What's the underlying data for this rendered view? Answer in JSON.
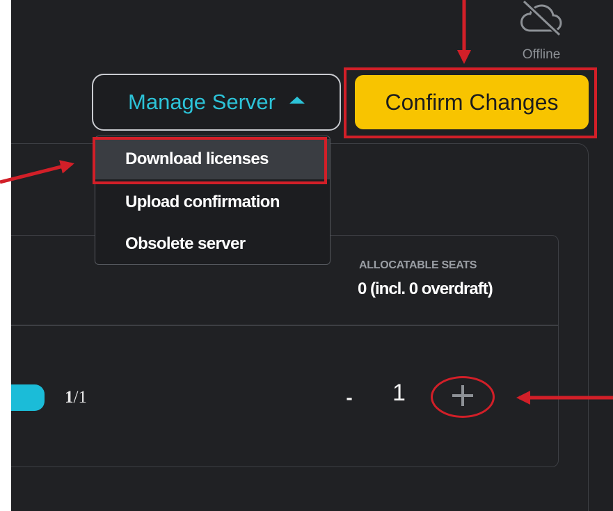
{
  "status": {
    "label": "Offline",
    "icon": "cloud-offline-icon"
  },
  "header": {
    "manage_server_label": "Manage Server",
    "confirm_changes_label": "Confirm Changes"
  },
  "dropdown": {
    "items": [
      {
        "label": "Download licenses",
        "selected": true
      },
      {
        "label": "Upload confirmation"
      },
      {
        "label": "Obsolete server"
      }
    ]
  },
  "seats": {
    "heading": "ALLOCATABLE SEATS",
    "value": "0 (incl. 0 overdraft)"
  },
  "row": {
    "used": "1",
    "slash": "/",
    "total": "1",
    "quantity": "1",
    "minus_label": "-"
  },
  "colors": {
    "accent": "#2cc3d8",
    "confirm": "#f8c400",
    "annotation": "#d21f28",
    "background": "#1f2023"
  }
}
